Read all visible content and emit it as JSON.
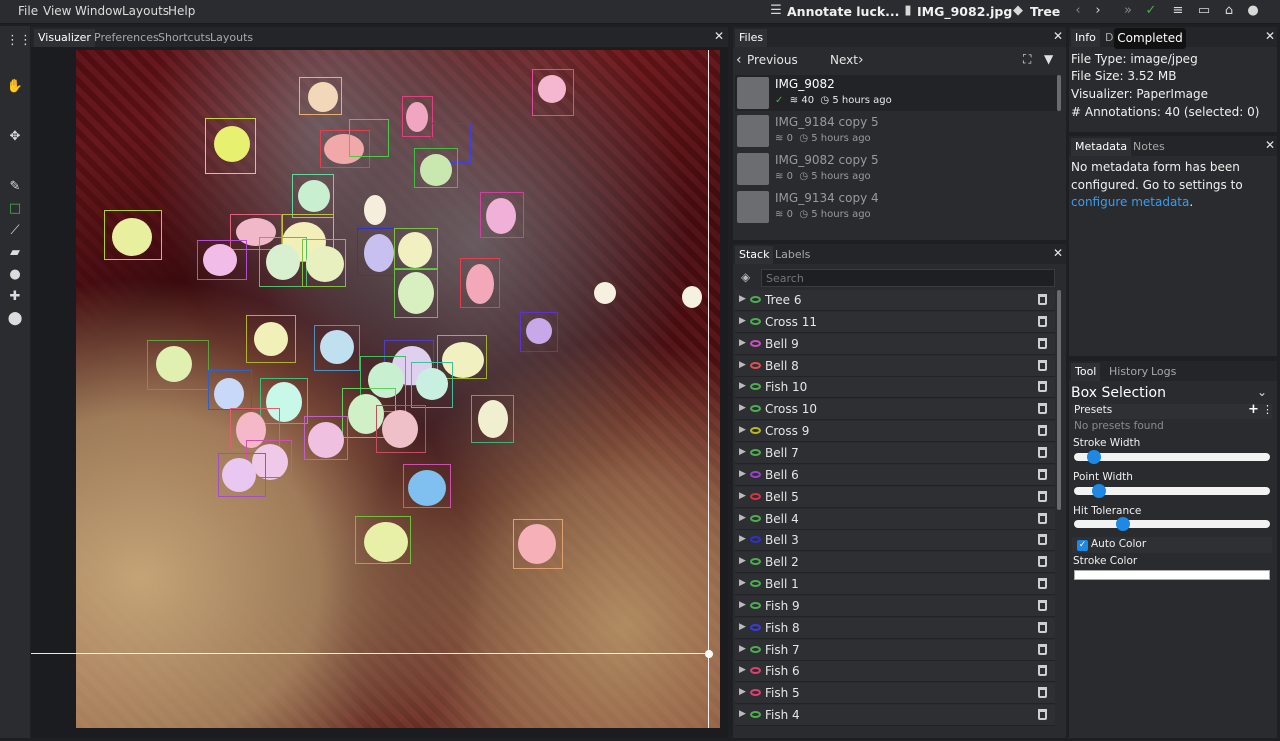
{
  "menu": [
    "File",
    "View",
    "Window",
    "Layouts",
    "Help"
  ],
  "toolbar": {
    "dataset": "Annotate luck...",
    "file": "IMG_9082.jpg",
    "category": "Tree",
    "tooltip": "Completed",
    "status_color": "#4caf50"
  },
  "visualizer": {
    "tabs": [
      "Visualizer",
      "Preferences",
      "Shortcuts",
      "Layouts"
    ]
  },
  "left_tools": [
    "dots-grid-icon",
    "hand-icon",
    "move-icon",
    "pencil-icon",
    "box-icon",
    "brush-icon",
    "eraser-icon",
    "circle-icon",
    "puzzle-icon",
    "pin-icon"
  ],
  "files": {
    "tab": "Files",
    "previous": "Previous",
    "next": "Next",
    "items": [
      {
        "name": "IMG_9082",
        "count": "40",
        "time": "5 hours ago"
      },
      {
        "name": "IMG_9184 copy 5",
        "count": "0",
        "time": "5 hours ago"
      },
      {
        "name": "IMG_9082 copy 5",
        "count": "0",
        "time": "5 hours ago"
      },
      {
        "name": "IMG_9134 copy 4",
        "count": "0",
        "time": "5 hours ago"
      }
    ]
  },
  "stack": {
    "tabs": [
      "Stack",
      "Labels"
    ],
    "search_placeholder": "Search",
    "items": [
      {
        "label": "Tree 6",
        "color": "#4caf50"
      },
      {
        "label": "Cross 11",
        "color": "#4caf50"
      },
      {
        "label": "Bell 9",
        "color": "#c850c0"
      },
      {
        "label": "Bell 8",
        "color": "#e05050"
      },
      {
        "label": "Fish 10",
        "color": "#4caf50"
      },
      {
        "label": "Cross 10",
        "color": "#4caf50"
      },
      {
        "label": "Cross 9",
        "color": "#b8b820"
      },
      {
        "label": "Bell 7",
        "color": "#4caf50"
      },
      {
        "label": "Bell 6",
        "color": "#9c40d0"
      },
      {
        "label": "Bell 5",
        "color": "#e03040"
      },
      {
        "label": "Bell 4",
        "color": "#4caf50"
      },
      {
        "label": "Bell 3",
        "color": "#3030d0"
      },
      {
        "label": "Bell 2",
        "color": "#4caf50"
      },
      {
        "label": "Bell 1",
        "color": "#4caf50"
      },
      {
        "label": "Fish 9",
        "color": "#4caf50"
      },
      {
        "label": "Fish 8",
        "color": "#3a3ae0"
      },
      {
        "label": "Fish 7",
        "color": "#4caf50"
      },
      {
        "label": "Fish 6",
        "color": "#e04070"
      },
      {
        "label": "Fish 5",
        "color": "#e04070"
      },
      {
        "label": "Fish 4",
        "color": "#4caf50"
      }
    ]
  },
  "info": {
    "tabs": [
      "Info",
      "D"
    ],
    "file_type": "File Type: image/jpeg",
    "file_size": "File Size: 3.52 MB",
    "visualizer": "Visualizer: PaperImage",
    "annotations": "# Annotations: 40 (selected: 0)"
  },
  "metadata": {
    "tabs": [
      "Metadata",
      "Notes"
    ],
    "text": "No metadata form has been configured. Go to settings to",
    "link": "configure metadata",
    "period": "."
  },
  "tool": {
    "tabs": [
      "Tool",
      "History",
      "Logs"
    ],
    "title": "Box Selection",
    "presets_label": "Presets",
    "presets_empty": "No presets found",
    "stroke_width_label": "Stroke Width",
    "stroke_width": 0.1,
    "point_width_label": "Point Width",
    "point_width": 0.13,
    "hit_tolerance_label": "Hit Tolerance",
    "hit_tolerance": 0.25,
    "auto_color_label": "Auto Color",
    "auto_color": true,
    "stroke_color_label": "Stroke Color"
  }
}
